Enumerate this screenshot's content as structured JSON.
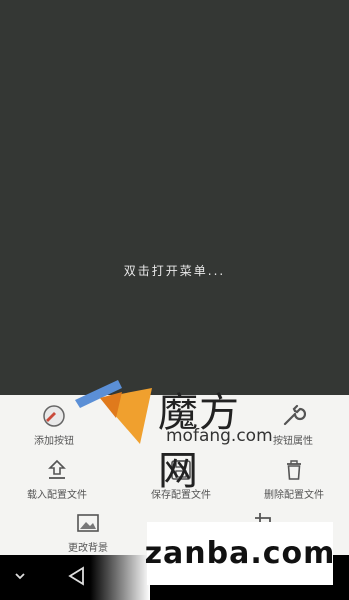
{
  "canvas": {
    "hint": "双击打开菜单..."
  },
  "menu": {
    "add_button": "添加按钮",
    "button_props": "按钮属性",
    "load_config": "载入配置文件",
    "save_config": "保存配置文件",
    "delete_config": "删除配置文件",
    "change_background": "更改背景"
  },
  "watermark": {
    "brand": "魔方网",
    "domain": "mofang.com",
    "site": "zanba.com"
  },
  "colors": {
    "canvas_bg": "#343734",
    "panel_bg": "#f4f4f2",
    "navbar_bg": "#000000"
  },
  "icons": [
    "add-button-icon",
    "wrench-icon",
    "upload-icon",
    "save-icon",
    "trash-icon",
    "image-icon",
    "crop-icon",
    "back-icon",
    "home-icon",
    "recents-icon",
    "chevron-down-icon"
  ]
}
